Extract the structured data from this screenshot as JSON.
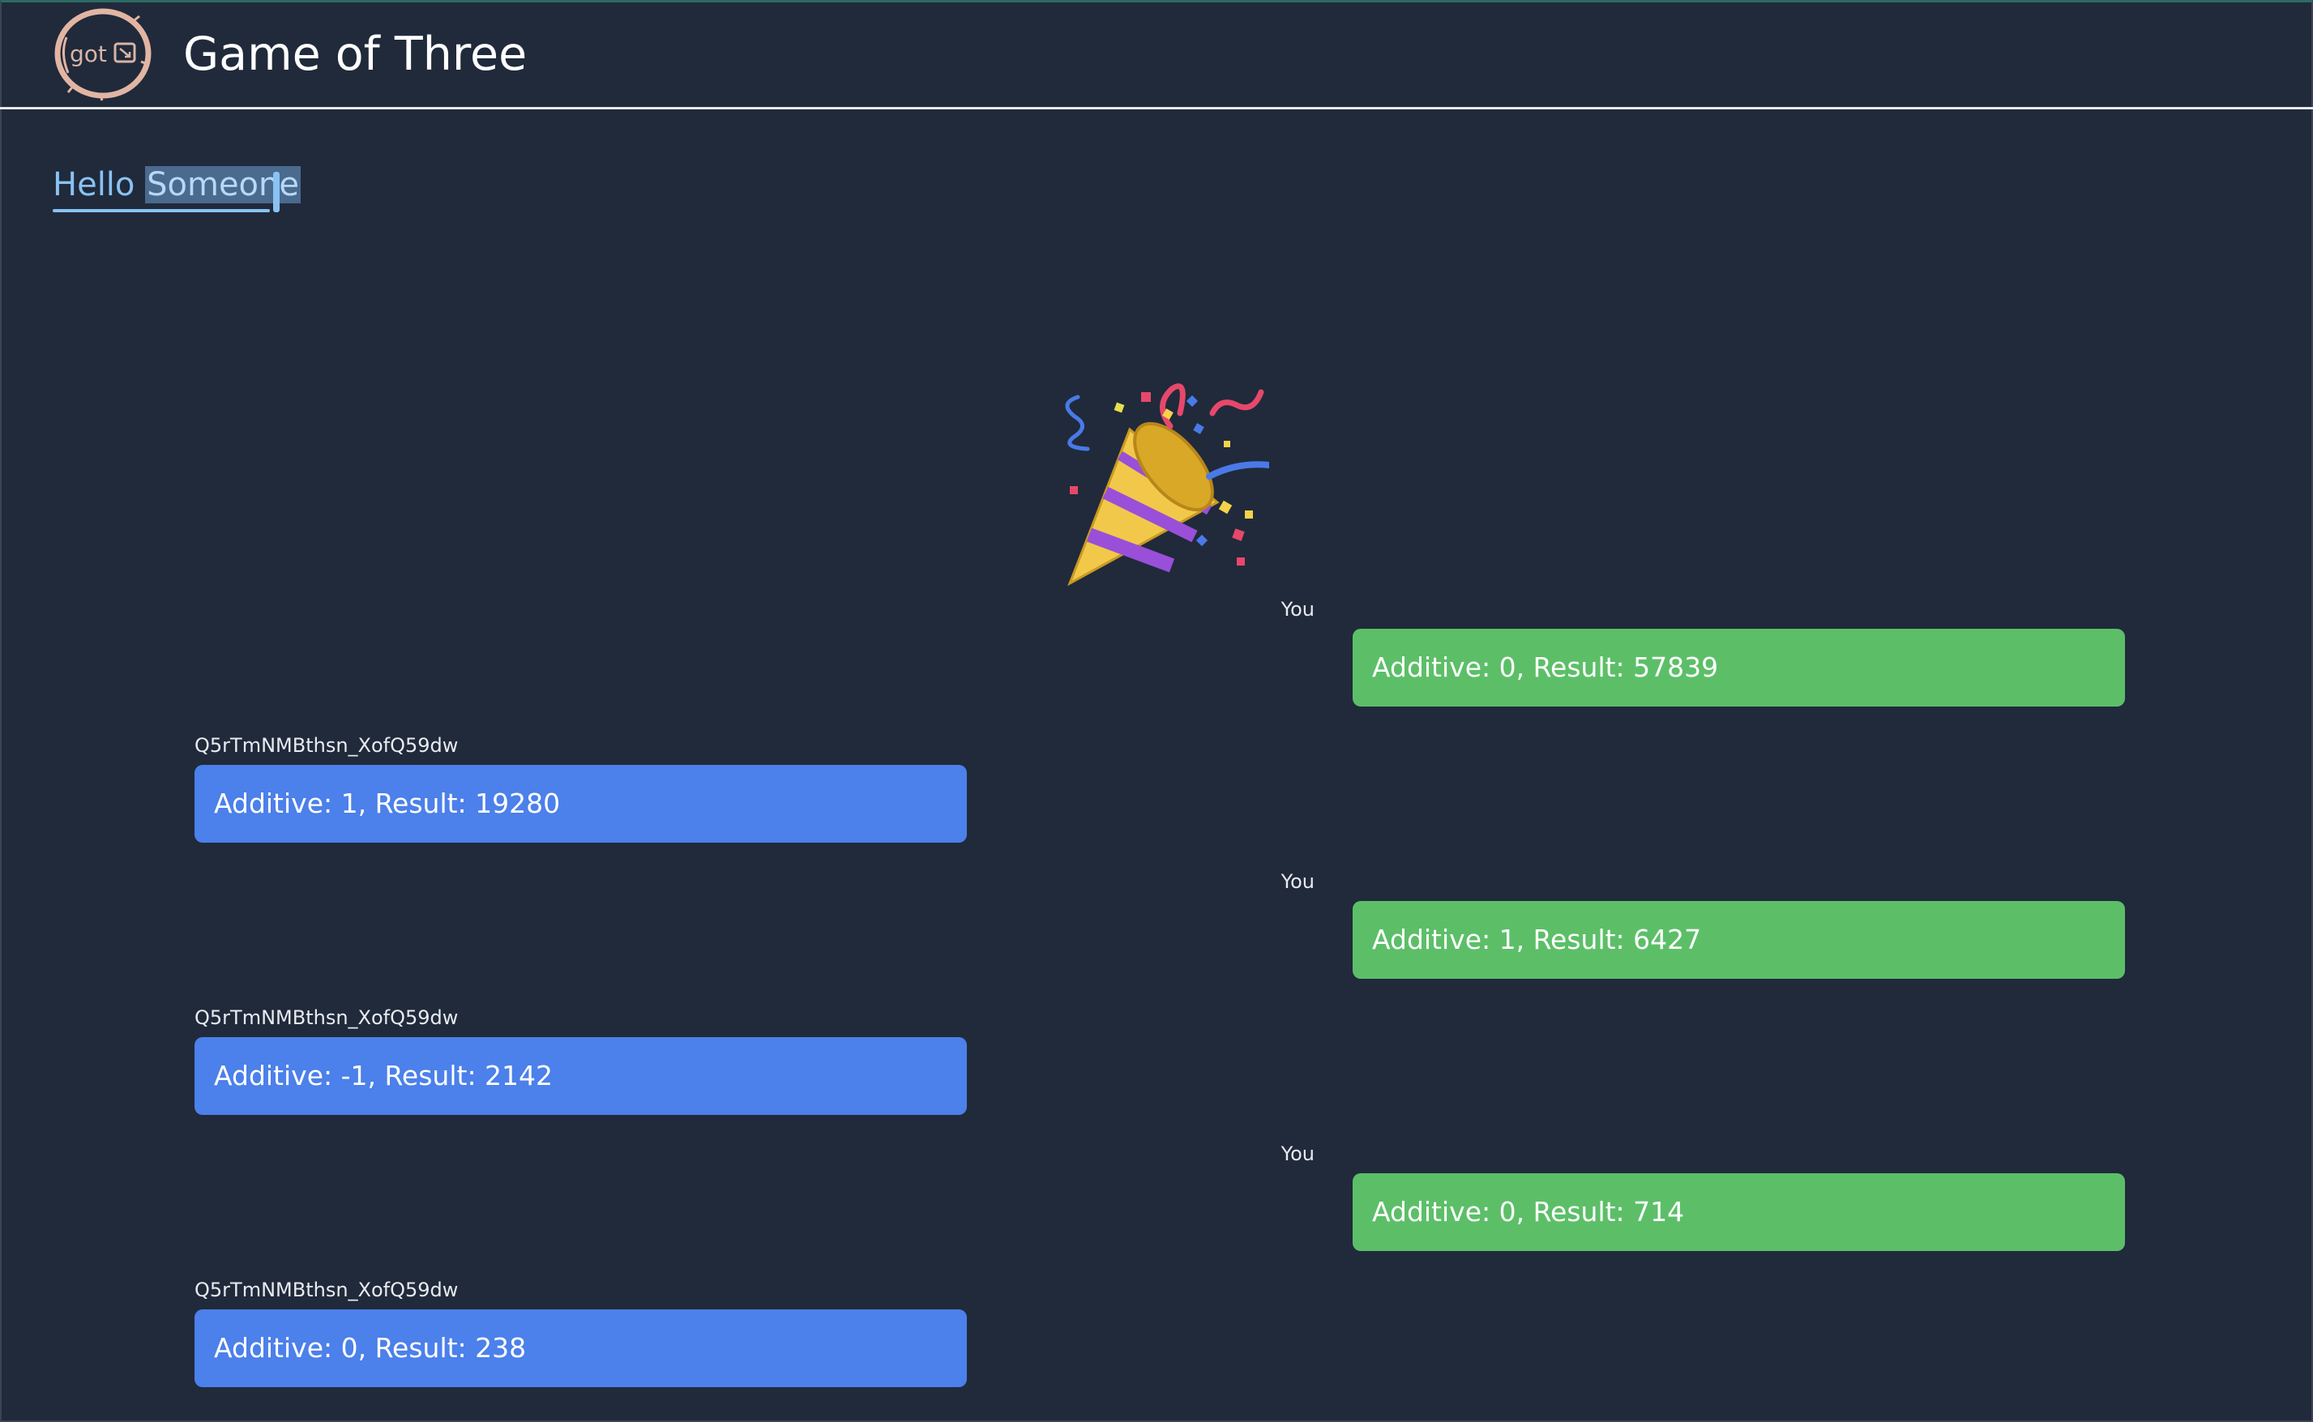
{
  "header": {
    "logo_text": "got",
    "title": "Game of Three"
  },
  "greeting": {
    "hello": "Hello ",
    "name": "Someone",
    "punctuation": ""
  },
  "celebration_icon": "party-popper",
  "moves": [
    {
      "sender": "You",
      "side": "mine",
      "text": "Additive: 0, Result: 57839"
    },
    {
      "sender": "Q5rTmNMBthsn_XofQ59dw",
      "side": "theirs",
      "text": "Additive: 1, Result: 19280"
    },
    {
      "sender": "You",
      "side": "mine",
      "text": "Additive: 1, Result: 6427"
    },
    {
      "sender": "Q5rTmNMBthsn_XofQ59dw",
      "side": "theirs",
      "text": "Additive: -1, Result: 2142"
    },
    {
      "sender": "You",
      "side": "mine",
      "text": "Additive: 0, Result: 714"
    },
    {
      "sender": "Q5rTmNMBthsn_XofQ59dw",
      "side": "theirs",
      "text": "Additive: 0, Result: 238"
    }
  ],
  "colors": {
    "background": "#202a3b",
    "my_move": "#5cbf68",
    "opponent_move": "#4c80ea",
    "greeting": "#89c2f3",
    "logo_ring": "#e2b5a3"
  }
}
